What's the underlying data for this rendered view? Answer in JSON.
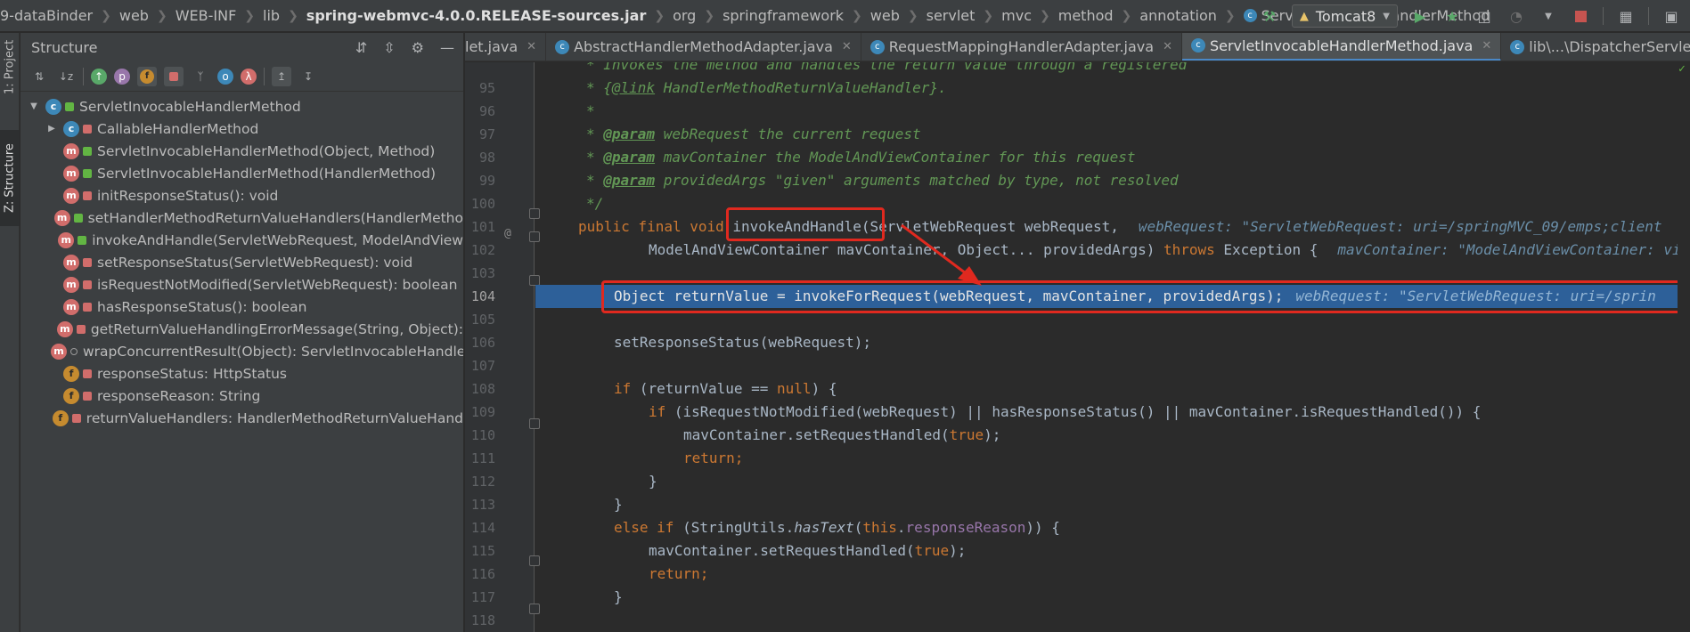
{
  "breadcrumbs": [
    "9-dataBinder",
    "web",
    "WEB-INF",
    "lib",
    "spring-webmvc-4.0.0.RELEASE-sources.jar",
    "org",
    "springframework",
    "web",
    "servlet",
    "mvc",
    "method",
    "annotation",
    "ServletInvocableHandlerMethod"
  ],
  "run_config": "Tomcat8",
  "left_strip": {
    "project": "1: Project",
    "structure": "Z: Structure"
  },
  "structure": {
    "title": "Structure",
    "root": "ServletInvocableHandlerMethod",
    "items": [
      {
        "kind": "c",
        "vis": "priv",
        "label": "CallableHandlerMethod",
        "expand": true
      },
      {
        "kind": "m",
        "vis": "pub",
        "label": "ServletInvocableHandlerMethod(Object, Method)"
      },
      {
        "kind": "m",
        "vis": "pub",
        "label": "ServletInvocableHandlerMethod(HandlerMethod)"
      },
      {
        "kind": "m",
        "vis": "priv",
        "label": "initResponseStatus(): void"
      },
      {
        "kind": "m",
        "vis": "pub",
        "label": "setHandlerMethodReturnValueHandlers(HandlerMetho"
      },
      {
        "kind": "m",
        "vis": "pub",
        "label": "invokeAndHandle(ServletWebRequest, ModelAndView"
      },
      {
        "kind": "m",
        "vis": "priv",
        "label": "setResponseStatus(ServletWebRequest): void"
      },
      {
        "kind": "m",
        "vis": "priv",
        "label": "isRequestNotModified(ServletWebRequest): boolean"
      },
      {
        "kind": "m",
        "vis": "priv",
        "label": "hasResponseStatus(): boolean"
      },
      {
        "kind": "m",
        "vis": "priv",
        "label": "getReturnValueHandlingErrorMessage(String, Object):"
      },
      {
        "kind": "m",
        "vis": "pkg",
        "label": "wrapConcurrentResult(Object): ServletInvocableHandle"
      },
      {
        "kind": "f",
        "vis": "priv",
        "label": "responseStatus: HttpStatus"
      },
      {
        "kind": "f",
        "vis": "priv",
        "label": "responseReason: String"
      },
      {
        "kind": "f",
        "vis": "priv",
        "label": "returnValueHandlers: HandlerMethodReturnValueHand"
      }
    ]
  },
  "tabs": [
    {
      "label": "let.java",
      "active": false
    },
    {
      "label": "AbstractHandlerMethodAdapter.java",
      "active": false
    },
    {
      "label": "RequestMappingHandlerAdapter.java",
      "active": false
    },
    {
      "label": "ServletInvocableHandlerMethod.java",
      "active": true
    },
    {
      "label": "lib\\...\\DispatcherServlet.java",
      "active": false
    }
  ],
  "code": {
    "line_numbers": [
      "95",
      "96",
      "97",
      "98",
      "99",
      "100",
      "101",
      "102",
      "103",
      "104",
      "105",
      "106",
      "107",
      "108",
      "109",
      "110",
      "111",
      "112",
      "113",
      "114",
      "115",
      "116",
      "117",
      "118"
    ],
    "current_line": "104",
    "l94_text": "* Invokes the method and handles the return value through a registered",
    "l95_star": "* {",
    "l95_tag": "@link",
    "l95_ref": " HandlerMethodReturnValueHandler",
    "l95_end": "}.",
    "l96": "*",
    "l97_star": "* ",
    "l97_tag": "@param",
    "l97_rest": " webRequest the current request",
    "l98_star": "* ",
    "l98_tag": "@param",
    "l98_rest": " mavContainer the ModelAndViewContainer for this request",
    "l99_star": "* ",
    "l99_tag": "@param",
    "l99_rest": " providedArgs \"given\" arguments matched by type, not resolved",
    "l100": "*/",
    "l101_kw": "public final void ",
    "l101_rest": "invokeAndHandle(ServletWebRequest webRequest,",
    "l101_hint": "webRequest: \"ServletWebRequest: uri=/springMVC_09/emps;client",
    "l102_code": "ModelAndViewContainer mavContainer, Object... providedArgs) ",
    "l102_kw": "throws ",
    "l102_rest": "Exception {",
    "l102_hint": "mavContainer: \"ModelAndViewContainer: vi",
    "l104_code": "Object returnValue = invokeForRequest(webRequest, mavContainer, providedArgs);",
    "l104_hint": "webRequest: \"ServletWebRequest: uri=/sprin",
    "l106": "setResponseStatus(webRequest);",
    "l108_kw": "if ",
    "l108_a": "(returnValue == ",
    "l108_null": "null",
    "l108_b": ") {",
    "l109_kw": "if ",
    "l109_rest": "(isRequestNotModified(webRequest) || hasResponseStatus() || mavContainer.isRequestHandled()) {",
    "l110_a": "mavContainer.setRequestHandled(",
    "l110_true": "true",
    "l110_b": ");",
    "l111": "return;",
    "l112": "}",
    "l113": "}",
    "l114_kw": "else if ",
    "l114_a": "(StringUtils.",
    "l114_st": "hasText",
    "l114_b": "(",
    "l114_this": "this",
    "l114_c": ".",
    "l114_fld": "responseReason",
    "l114_d": ")) {",
    "l115_a": "mavContainer.setRequestHandled(",
    "l115_true": "true",
    "l115_b": ");",
    "l116": "return;",
    "l117": "}"
  },
  "colors": {
    "highlight": "#2d6099",
    "annotation": "#e0291f",
    "keyword": "#cc7832",
    "comment": "#629755"
  }
}
